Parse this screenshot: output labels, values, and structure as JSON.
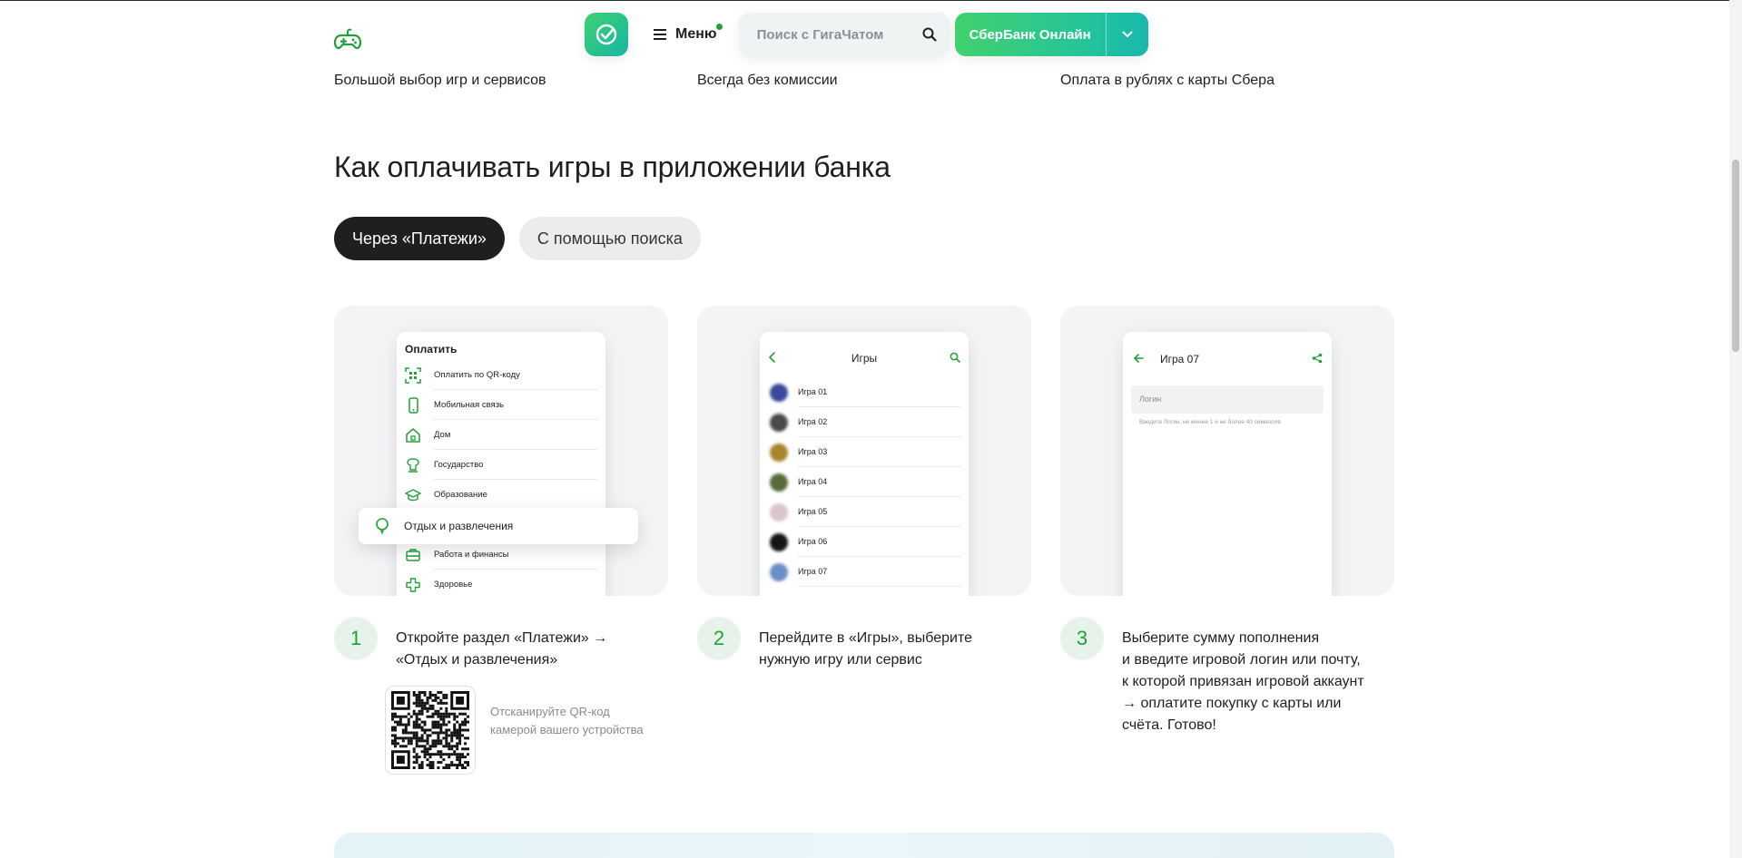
{
  "header": {
    "menu_label": "Меню",
    "search_placeholder": "Поиск с ГигаЧатом",
    "sberbank_online_label": "СберБанк Онлайн"
  },
  "features": [
    "Большой выбор игр и сервисов",
    "Всегда без комиссии",
    "Оплата в рублях с карты Сбера"
  ],
  "section": {
    "title": "Как оплачивать игры в приложении банка"
  },
  "tabs": [
    {
      "label": "Через «Платежи»",
      "active": true
    },
    {
      "label": "С помощью поиска",
      "active": false
    }
  ],
  "card1": {
    "title": "Оплатить",
    "items": [
      "Оплатить по QR-коду",
      "Мобильная связь",
      "Дом",
      "Государство",
      "Образование",
      "Работа и финансы",
      "Здоровье"
    ],
    "highlighted": "Отдых и развлечения"
  },
  "card2": {
    "title": "Игры",
    "games": [
      "Игра 01",
      "Игра 02",
      "Игра 03",
      "Игра 04",
      "Игра 05",
      "Игра 06",
      "Игра 07"
    ]
  },
  "card3": {
    "title": "Игра 07",
    "login_placeholder": "Логин",
    "login_hint": "Введите Логин, не менее 1 и не более 40 символов"
  },
  "steps": [
    {
      "number": "1",
      "lines": [
        "Откройте раздел «Платежи» →",
        "«Отдых и развлечения»"
      ]
    },
    {
      "number": "2",
      "lines": [
        "Перейдите в «Игры», выберите",
        "нужную игру или сервис"
      ]
    },
    {
      "number": "3",
      "lines": [
        "Выберите сумму пополнения",
        "и введите игровой логин или почту,",
        "к которой привязан игровой аккаунт",
        "→ оплатите покупку с карты или",
        "счёта. Готово!"
      ]
    }
  ],
  "qr_hint": "Отсканируйте QR-код камерой вашего устройства",
  "colors": {
    "brand_green": "#21a038",
    "tab_active_bg": "#1f1f22",
    "step_badge_bg": "#e6f3ea"
  },
  "icons": [
    "gamepad-icon",
    "sber-check-icon",
    "hamburger-icon",
    "search-icon",
    "chevron-down-icon",
    "qr-scan-icon",
    "phone-icon",
    "house-icon",
    "government-icon",
    "graduation-cap-icon",
    "balloon-icon",
    "briefcase-icon",
    "health-cross-icon",
    "back-arrow-icon",
    "share-icon"
  ]
}
